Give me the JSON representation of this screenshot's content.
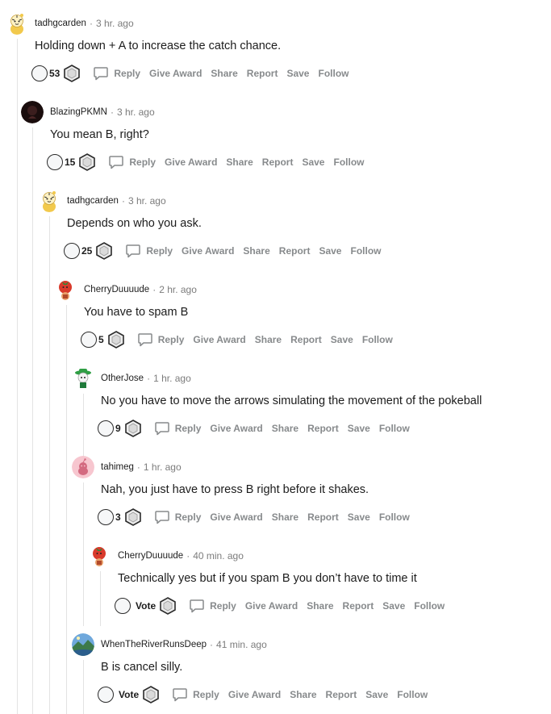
{
  "comments": [
    {
      "username": "tadhgcarden",
      "time": "3 hr. ago",
      "body": "Holding down + A to increase the catch chance.",
      "score": "53"
    },
    {
      "username": "BlazingPKMN",
      "time": "3 hr. ago",
      "body": "You mean B, right?",
      "score": "15"
    },
    {
      "username": "tadhgcarden",
      "time": "3 hr. ago",
      "body": "Depends on who you ask.",
      "score": "25"
    },
    {
      "username": "CherryDuuuude",
      "time": "2 hr. ago",
      "body": "You have to spam B",
      "score": "5"
    },
    {
      "username": "OtherJose",
      "time": "1 hr. ago",
      "body": "No you have to move the arrows simulating the movement of the pokeball",
      "score": "9"
    },
    {
      "username": "tahimeg",
      "time": "1 hr. ago",
      "body": "Nah, you just have to press B right before it shakes.",
      "score": "3"
    },
    {
      "username": "CherryDuuuude",
      "time": "40 min. ago",
      "body": "Technically yes but if you spam B you don’t have to time it",
      "score": "Vote"
    },
    {
      "username": "WhenTheRiverRunsDeep",
      "time": "41 min. ago",
      "body": "B is cancel silly.",
      "score": "Vote"
    }
  ],
  "actions": {
    "reply": "Reply",
    "give_award": "Give Award",
    "share": "Share",
    "report": "Report",
    "save": "Save",
    "follow": "Follow"
  },
  "separator": "·",
  "avatars": [
    "tiger-snoo-avatar",
    "dark-avatar",
    "tiger-snoo-avatar",
    "tomato-snoo-avatar",
    "green-hat-snoo-avatar",
    "pink-default-avatar",
    "tomato-snoo-avatar",
    "landscape-avatar"
  ],
  "colors": {
    "thread_line": "#e3e3e3",
    "muted_text": "#878a8c",
    "meta_text": "#7c7c7c",
    "text": "#1c1c1c"
  }
}
